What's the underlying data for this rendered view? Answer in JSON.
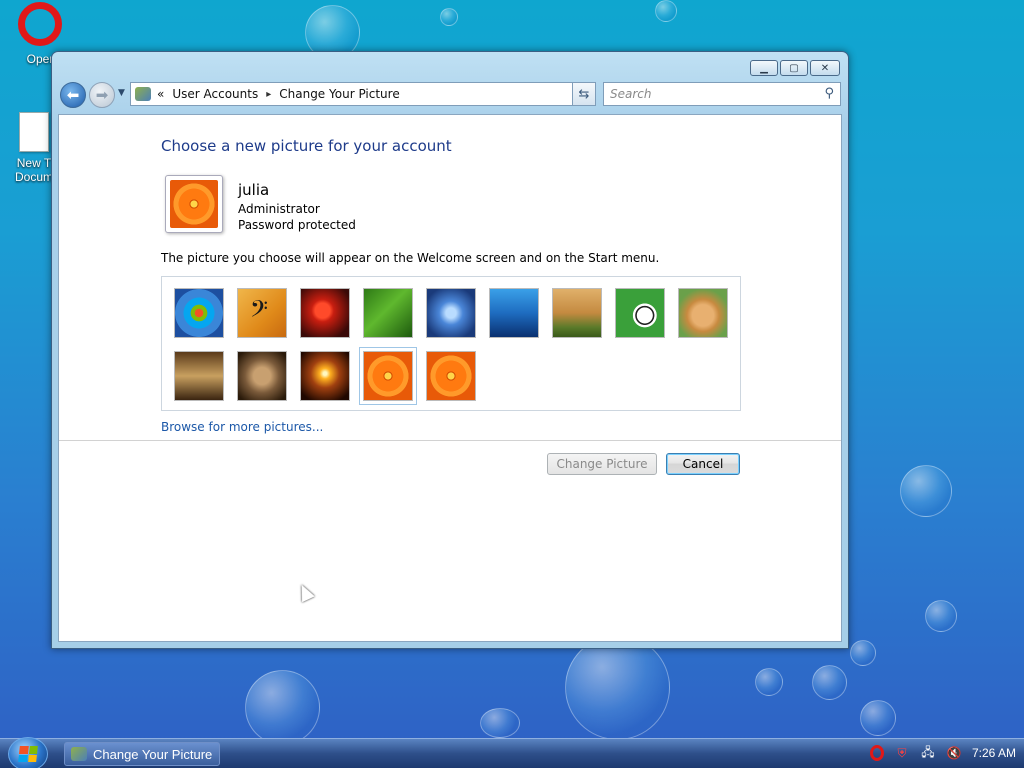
{
  "desktop": {
    "icons": [
      {
        "label": "Oper"
      },
      {
        "label": "New T\nDocum"
      }
    ]
  },
  "window": {
    "controls": {
      "minimize": "▁",
      "maximize": "▢",
      "close": "✕"
    },
    "address": {
      "prefix": "«",
      "crumb1": "User Accounts",
      "sep": "▸",
      "crumb2": "Change Your Picture",
      "dropdown": "▼"
    },
    "search": {
      "placeholder": "Search"
    },
    "heading": "Choose a new picture for your account",
    "user": {
      "name": "julia",
      "role": "Administrator",
      "status": "Password protected"
    },
    "description": "The picture you choose will appear on the Welcome screen and on the Start menu.",
    "pictures": [
      {
        "name": "windows-logo",
        "selected": false
      },
      {
        "name": "music-clef",
        "selected": false
      },
      {
        "name": "starfish",
        "selected": false
      },
      {
        "name": "leaf",
        "selected": false
      },
      {
        "name": "flower-blue",
        "selected": false
      },
      {
        "name": "underwater",
        "selected": false
      },
      {
        "name": "bonsai",
        "selected": false
      },
      {
        "name": "soccer-ball",
        "selected": false
      },
      {
        "name": "dog",
        "selected": false
      },
      {
        "name": "chess",
        "selected": false
      },
      {
        "name": "kitten",
        "selected": false
      },
      {
        "name": "sparkles",
        "selected": false
      },
      {
        "name": "orange-daisy",
        "selected": true
      },
      {
        "name": "orange-daisy-2",
        "selected": false
      }
    ],
    "browse_link": "Browse for more pictures...",
    "buttons": {
      "change": "Change Picture",
      "cancel": "Cancel"
    }
  },
  "taskbar": {
    "task_label": "Change Your Picture",
    "clock": "7:26 AM"
  }
}
